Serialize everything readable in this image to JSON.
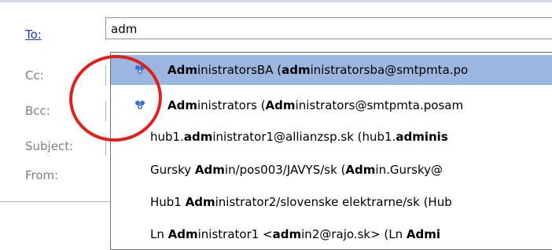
{
  "form": {
    "to_label": "To:",
    "to_value": "adm",
    "cc_label": "Cc:",
    "bcc_label": "Bcc:",
    "subject_label": "Subject:",
    "from_label": "From:"
  },
  "suggestions": [
    {
      "icon": "group-icon",
      "bold": "Adm",
      "rest1": "inistratorsBA (",
      "bold2": "adm",
      "rest2": "inistratorsba@smtpmta.po"
    },
    {
      "icon": "group-icon",
      "bold": "Adm",
      "rest1": "inistrators (",
      "bold2": "Adm",
      "rest2": "inistrators@smtpmta.posam"
    },
    {
      "pre": "hub1.",
      "bold": "adm",
      "rest1": "inistrator1@allianzsp.sk (hub1.",
      "bold2": "adminis",
      "rest2": ""
    },
    {
      "pre": "Gursky ",
      "bold": "Adm",
      "rest1": "in/pos003/JAVYS/sk (",
      "bold2": "Adm",
      "rest2": "in.Gursky@"
    },
    {
      "pre": "Hub1 ",
      "bold": "Adm",
      "rest1": "inistrator2/slovenske elektrarne/sk (Hub",
      "bold2": "",
      "rest2": ""
    },
    {
      "pre": "Ln ",
      "bold": "Adm",
      "rest1": "inistrator1 <",
      "bold2": "adm",
      "rest2": "in2@rajo.sk> (Ln ",
      "bold3": "Admi"
    }
  ],
  "colors": {
    "selected_row": "#9cb7df",
    "annotation_circle": "#e0201f",
    "link": "#1f3fbf"
  }
}
